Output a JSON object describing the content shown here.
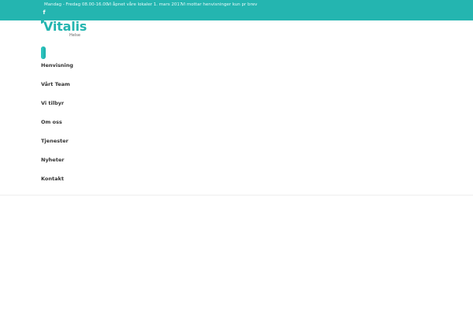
{
  "topbar": {
    "hours": "Mandag - Fredag 08.00-16.00",
    "opening": "Vi åpnet våre lokaler 1. mars 2017.",
    "referrals": "Vi mottar henvisninger kun pr brev",
    "social_icon": "facebook-icon",
    "social_glyph": "f",
    "background_color": "#24b5b0"
  },
  "logo": {
    "name": "Vitalis",
    "sub": "Helse",
    "color": "#24b5b0"
  },
  "nav": {
    "items": [
      {
        "label": "Henvisning"
      },
      {
        "label": "Vårt Team"
      },
      {
        "label": "Vi tilbyr"
      },
      {
        "label": "Om oss"
      },
      {
        "label": "Tjenester"
      },
      {
        "label": "Nyheter"
      },
      {
        "label": "Kontakt"
      }
    ]
  }
}
